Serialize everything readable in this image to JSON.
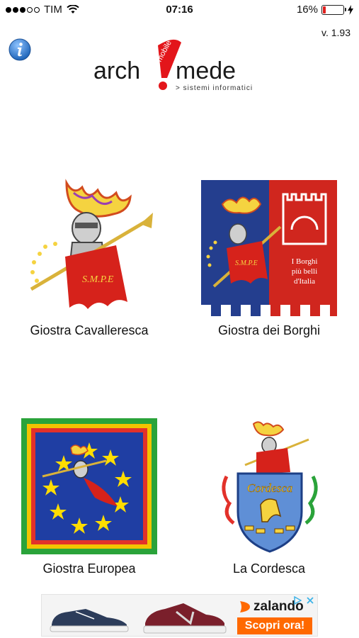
{
  "status_bar": {
    "carrier": "TIM",
    "time": "07:16",
    "battery_percent": "16%",
    "battery_level": 0.16,
    "signal_bars_on": 3,
    "signal_bars_total": 5
  },
  "header": {
    "version": "v. 1.93",
    "logo_main": "arch!mede",
    "logo_tag": "mobile",
    "logo_sub": "> sistemi informatici"
  },
  "tiles": [
    {
      "label": "Giostra Cavalleresca",
      "icon": "knight-smpe-icon"
    },
    {
      "label": "Giostra dei Borghi",
      "icon": "borghi-banner-icon",
      "banner_text": [
        "I Borghi",
        "più belli",
        "d'Italia"
      ]
    },
    {
      "label": "Giostra Europea",
      "icon": "europe-flag-knight-icon"
    },
    {
      "label": "La Cordesca",
      "icon": "cordesca-crest-icon",
      "crest_text": "Cordesca"
    }
  ],
  "ad": {
    "brand": "zalando",
    "cta": "Scopri ora!",
    "colors": {
      "brand": "#ff6900",
      "cta": "#ff6900"
    }
  },
  "colors": {
    "info_blue": "#2e7fd6",
    "logo_red": "#e3151a",
    "borghi_blue": "#243e8e",
    "borghi_red": "#d0261e",
    "europe_blue": "#1f3ea3",
    "star_yellow": "#ffdd00"
  }
}
